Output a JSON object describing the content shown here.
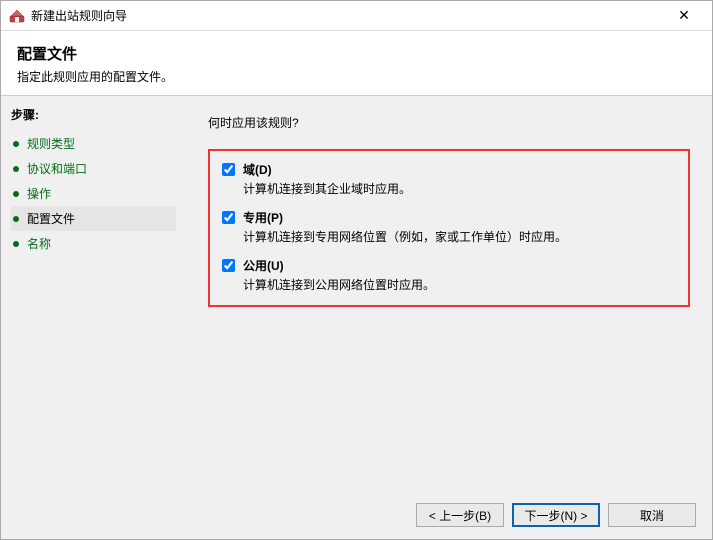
{
  "titlebar": {
    "title": "新建出站规则向导",
    "close_symbol": "✕"
  },
  "header": {
    "title": "配置文件",
    "subtitle": "指定此规则应用的配置文件。"
  },
  "sidebar": {
    "steps_label": "步骤:",
    "items": [
      {
        "label": "规则类型",
        "current": false
      },
      {
        "label": "协议和端口",
        "current": false
      },
      {
        "label": "操作",
        "current": false
      },
      {
        "label": "配置文件",
        "current": true
      },
      {
        "label": "名称",
        "current": false
      }
    ]
  },
  "content": {
    "question": "何时应用该规则?",
    "options": [
      {
        "label": "域(D)",
        "desc": "计算机连接到其企业域时应用。",
        "checked": true
      },
      {
        "label": "专用(P)",
        "desc": "计算机连接到专用网络位置（例如，家或工作单位）时应用。",
        "checked": true
      },
      {
        "label": "公用(U)",
        "desc": "计算机连接到公用网络位置时应用。",
        "checked": true
      }
    ]
  },
  "footer": {
    "back": "< 上一步(B)",
    "next": "下一步(N) >",
    "cancel": "取消"
  }
}
